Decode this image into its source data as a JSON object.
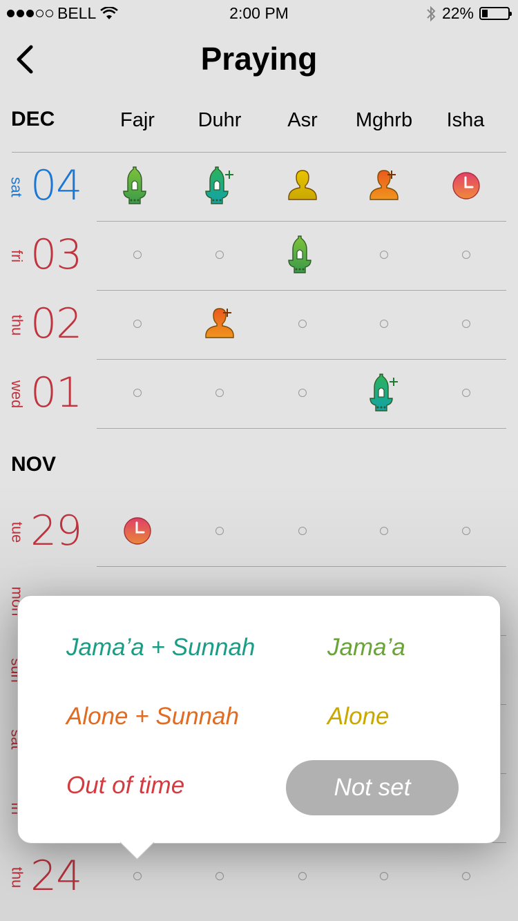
{
  "status_bar": {
    "carrier": "BELL",
    "time": "2:00 PM",
    "battery": "22%"
  },
  "nav": {
    "title": "Praying"
  },
  "columns": [
    "Fajr",
    "Duhr",
    "Asr",
    "Mghrb",
    "Isha"
  ],
  "months": {
    "dec": "DEC",
    "nov": "NOV"
  },
  "days": [
    {
      "weekday": "sat",
      "num": "04",
      "color": "#1a78d4",
      "cells": [
        "jamaa",
        "jamaa-sunnah",
        "alone",
        "alone-sunnah",
        "out"
      ]
    },
    {
      "weekday": "fri",
      "num": "03",
      "color": "#c0343f",
      "cells": [
        "empty",
        "empty",
        "jamaa",
        "empty",
        "empty"
      ]
    },
    {
      "weekday": "thu",
      "num": "02",
      "color": "#c0343f",
      "cells": [
        "empty",
        "alone-sunnah",
        "empty",
        "empty",
        "empty"
      ]
    },
    {
      "weekday": "wed",
      "num": "01",
      "color": "#c0343f",
      "cells": [
        "empty",
        "empty",
        "empty",
        "jamaa-sunnah",
        "empty"
      ]
    },
    {
      "weekday": "tue",
      "num": "29",
      "color": "#c0343f",
      "cells": [
        "out",
        "empty",
        "empty",
        "empty",
        "empty"
      ]
    },
    {
      "weekday": "thu",
      "num": "24",
      "color": "#c0343f",
      "cells": [
        "empty",
        "empty",
        "empty",
        "empty",
        "empty"
      ]
    }
  ],
  "hidden_weekdays": [
    "mon",
    "sun",
    "sat",
    "fri"
  ],
  "popup": {
    "jamaa_sunnah": "Jama’a + Sunnah",
    "jamaa": "Jama’a",
    "alone_sunnah": "Alone + Sunnah",
    "alone": "Alone",
    "out_of_time": "Out of time",
    "not_set": "Not set"
  },
  "colors": {
    "jamaa_sunnah": "#1a9c85",
    "jamaa": "#6aa338",
    "alone_sunnah": "#e06b22",
    "alone": "#c9a800",
    "out_of_time": "#d53a40",
    "today": "#1a78d4",
    "past": "#c0343f"
  },
  "icons": {
    "jamaa": "mosque-icon",
    "jamaa-sunnah": "mosque-plus-icon",
    "alone": "person-icon",
    "alone-sunnah": "person-plus-icon",
    "out": "clock-icon",
    "empty": "empty-dot-icon"
  }
}
